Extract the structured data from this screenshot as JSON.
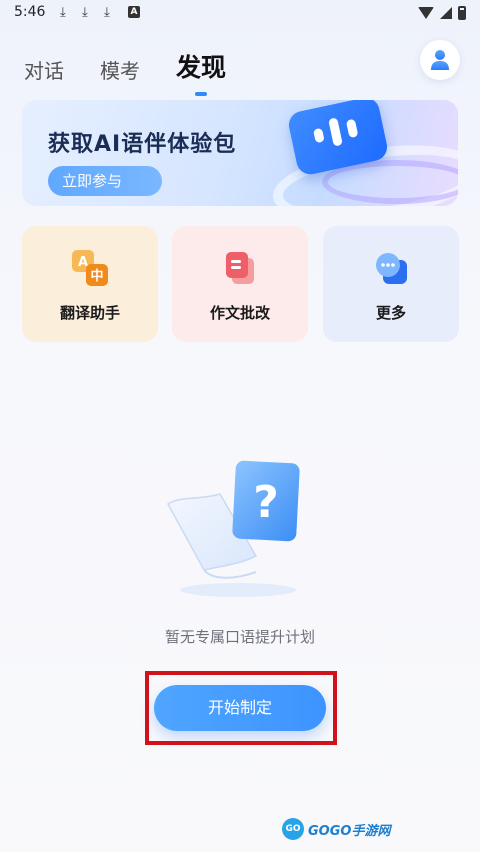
{
  "status_bar": {
    "time": "5:46",
    "download_icons": [
      "download-icon",
      "download-icon",
      "download-icon"
    ],
    "letter_badge": "A"
  },
  "header": {
    "tabs": [
      {
        "label": "对话"
      },
      {
        "label": "模考"
      },
      {
        "label": "发现"
      }
    ],
    "active_tab": "发现",
    "accent": "#2f8cf7"
  },
  "banner": {
    "title": "获取AI语伴体验包",
    "button_label": "立即参与"
  },
  "quick_actions": [
    {
      "label": "翻译助手",
      "icon": "translate-icon",
      "color": "#fbefdc"
    },
    {
      "label": "作文批改",
      "icon": "document-icon",
      "color": "#fdeaea"
    },
    {
      "label": "更多",
      "icon": "more-chat-icon",
      "color": "#e7edfa"
    }
  ],
  "empty_state": {
    "message": "暂无专属口语提升计划",
    "button_label": "开始制定"
  },
  "watermark": {
    "logo": "GO",
    "text": "GOGO手游网"
  }
}
